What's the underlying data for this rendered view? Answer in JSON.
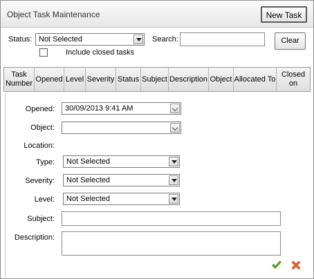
{
  "window": {
    "title": "Object Task Maintenance",
    "new_task_label": "New Task"
  },
  "filter": {
    "status_label": "Status:",
    "status_value": "Not Selected",
    "search_label": "Search:",
    "search_value": "",
    "clear_label": "Clear",
    "include_closed_label": "Include closed tasks",
    "include_closed_checked": false
  },
  "grid": {
    "columns": [
      "Task Number",
      "Opened",
      "Level",
      "Severity",
      "Status",
      "Subject",
      "Description",
      "Object",
      "Allocated To",
      "Closed on"
    ]
  },
  "form": {
    "opened_label": "Opened:",
    "opened_value": "30/09/2013 9:41 AM",
    "object_label": "Object:",
    "object_value": "",
    "location_label": "Location:",
    "type_label": "Type:",
    "type_value": "Not Selected",
    "severity_label": "Severity:",
    "severity_value": "Not Selected",
    "level_label": "Level:",
    "level_value": "Not Selected",
    "subject_label": "Subject:",
    "subject_value": "",
    "description_label": "Description:",
    "description_value": ""
  },
  "actions": {
    "save_icon": "check-icon",
    "cancel_icon": "x-icon",
    "save_color": "#5cab1e",
    "cancel_color": "#e8632a"
  }
}
